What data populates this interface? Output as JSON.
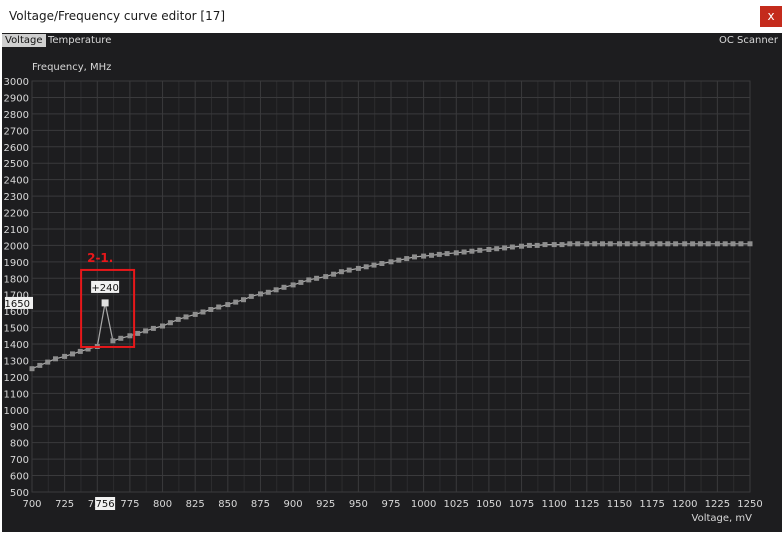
{
  "window": {
    "title": "Voltage/Frequency curve editor [17]",
    "close_label": "x"
  },
  "tabs": [
    {
      "label": "Voltage",
      "active": true
    },
    {
      "label": "Temperature",
      "active": false
    }
  ],
  "oc_scanner_label": "OC Scanner",
  "annotation": {
    "label": "2-1.",
    "color": "#e8171a",
    "offset_label": "+240",
    "selected_frequency": "1650",
    "selected_voltage": "756"
  },
  "chart_data": {
    "type": "line",
    "xlabel": "Voltage, mV",
    "ylabel": "Frequency, MHz",
    "xlim": [
      700,
      1250
    ],
    "ylim": [
      500,
      3000
    ],
    "x_ticks": [
      700,
      725,
      750,
      775,
      800,
      825,
      850,
      875,
      900,
      925,
      950,
      975,
      1000,
      1025,
      1050,
      1075,
      1100,
      1125,
      1150,
      1175,
      1200,
      1225,
      1250
    ],
    "y_ticks": [
      500,
      600,
      700,
      800,
      900,
      1000,
      1100,
      1200,
      1300,
      1400,
      1500,
      1600,
      1700,
      1800,
      1900,
      2000,
      2100,
      2200,
      2300,
      2400,
      2500,
      2600,
      2700,
      2800,
      2900,
      3000
    ],
    "grid": true,
    "series": [
      {
        "x": [
          700,
          706,
          712,
          718,
          725,
          731,
          737,
          743,
          750,
          756,
          762,
          768,
          775,
          781,
          787,
          793,
          800,
          806,
          812,
          818,
          825,
          831,
          837,
          843,
          850,
          856,
          862,
          868,
          875,
          881,
          887,
          893,
          900,
          906,
          912,
          918,
          925,
          931,
          937,
          943,
          950,
          956,
          962,
          968,
          975,
          981,
          987,
          993,
          1000,
          1006,
          1012,
          1018,
          1025,
          1031,
          1037,
          1043,
          1050,
          1056,
          1062,
          1068,
          1075,
          1081,
          1087,
          1093,
          1100,
          1106,
          1112,
          1118,
          1125,
          1131,
          1137,
          1143,
          1150,
          1156,
          1162,
          1168,
          1175,
          1181,
          1187,
          1193,
          1200,
          1206,
          1212,
          1218,
          1225,
          1231,
          1237,
          1243,
          1250
        ],
        "y": [
          1250,
          1270,
          1290,
          1310,
          1325,
          1340,
          1355,
          1370,
          1385,
          1650,
          1420,
          1435,
          1450,
          1465,
          1480,
          1495,
          1510,
          1530,
          1550,
          1565,
          1580,
          1595,
          1610,
          1625,
          1640,
          1655,
          1670,
          1690,
          1705,
          1715,
          1730,
          1745,
          1760,
          1775,
          1790,
          1800,
          1810,
          1825,
          1840,
          1850,
          1860,
          1870,
          1880,
          1890,
          1900,
          1910,
          1920,
          1930,
          1935,
          1940,
          1945,
          1950,
          1955,
          1960,
          1965,
          1970,
          1975,
          1980,
          1985,
          1990,
          1995,
          2000,
          2000,
          2005,
          2005,
          2005,
          2010,
          2010,
          2010,
          2010,
          2010,
          2010,
          2010,
          2010,
          2010,
          2010,
          2010,
          2010,
          2010,
          2010,
          2010,
          2010,
          2010,
          2010,
          2010,
          2010,
          2010,
          2010,
          2010
        ]
      }
    ]
  }
}
